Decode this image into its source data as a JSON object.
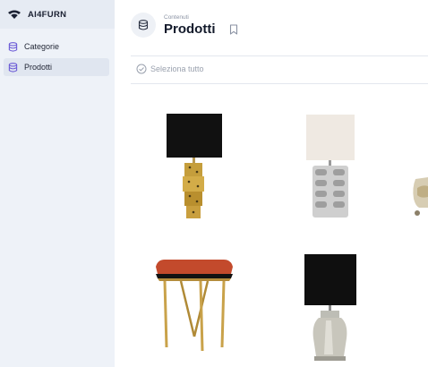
{
  "brand": {
    "name": "AI4FURN",
    "logo_icon": "wifi-icon"
  },
  "sidebar": {
    "items": [
      {
        "label": "Categorie",
        "icon": "database-icon",
        "active": false
      },
      {
        "label": "Prodotti",
        "icon": "database-icon",
        "active": true
      }
    ]
  },
  "header": {
    "breadcrumb": "Contenuti",
    "title": "Prodotti",
    "icon": "database-icon",
    "bookmark_icon": "bookmark-icon"
  },
  "toolbar": {
    "select_all_label": "Seleziona tutto",
    "select_all_icon": "check-circle-icon"
  },
  "products": [
    {
      "thumbnail": "black-shade-gold-cube-lamp"
    },
    {
      "thumbnail": "white-shade-silver-lamp"
    },
    {
      "thumbnail": "partial-beige-lamp"
    },
    {
      "thumbnail": "red-cushion-gold-stool"
    },
    {
      "thumbnail": "black-shade-silver-vase-lamp"
    }
  ],
  "colors": {
    "accent": "#6b5bd6",
    "sidebar_bg": "#eef2f8",
    "active_bg": "#e0e6f0"
  }
}
